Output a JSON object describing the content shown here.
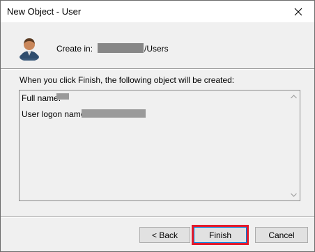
{
  "window": {
    "title": "New Object - User",
    "close_icon": "close-icon"
  },
  "header": {
    "icon": "user-icon",
    "create_label": "Create in:",
    "create_path_suffix": "/Users"
  },
  "body": {
    "info_text": "When you click Finish, the following object will be created:",
    "summary": {
      "full_name_label": "Full name:",
      "logon_label": "User logon name:"
    }
  },
  "buttons": {
    "back": "< Back",
    "finish": "Finish",
    "cancel": "Cancel"
  },
  "colors": {
    "highlight": "#e21b2c",
    "focus": "#0078d7"
  }
}
